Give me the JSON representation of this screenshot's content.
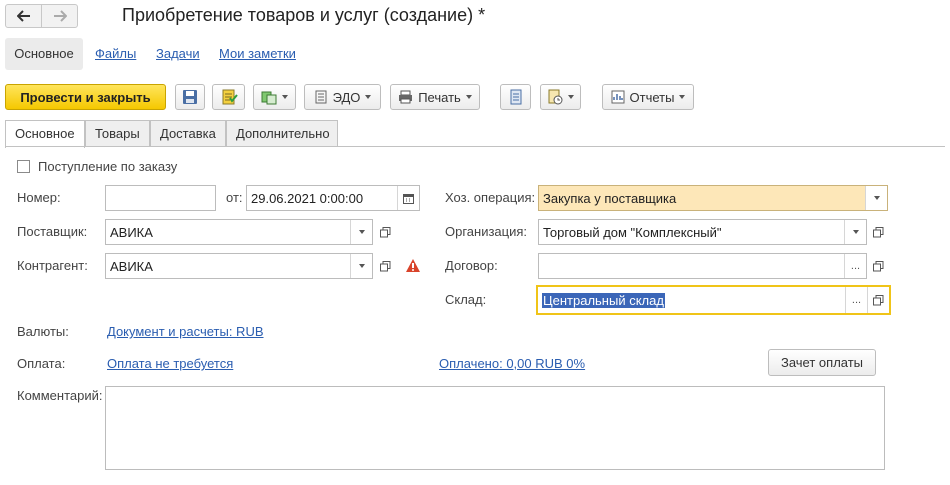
{
  "window": {
    "title": "Приобретение товаров и услуг (создание) *"
  },
  "nav": {
    "back_icon": "arrow-left-icon",
    "forward_icon": "arrow-right-icon"
  },
  "sections": [
    {
      "label": "Основное",
      "active": true
    },
    {
      "label": "Файлы"
    },
    {
      "label": "Задачи"
    },
    {
      "label": "Мои заметки"
    }
  ],
  "toolbar": {
    "post_close": "Провести и закрыть",
    "edo": "ЭДО",
    "print": "Печать",
    "reports": "Отчеты"
  },
  "tabs": [
    {
      "label": "Основное",
      "active": true
    },
    {
      "label": "Товары"
    },
    {
      "label": "Доставка"
    },
    {
      "label": "Дополнительно"
    }
  ],
  "form": {
    "by_order_label": "Поступление по заказу",
    "by_order_checked": false,
    "number_label": "Номер:",
    "number_value": "",
    "date_label": "от:",
    "date_value": "29.06.2021  0:00:00",
    "supplier_label": "Поставщик:",
    "supplier_value": "АВИКА",
    "counterparty_label": "Контрагент:",
    "counterparty_value": "АВИКА",
    "operation_label": "Хоз. операция:",
    "operation_value": "Закупка у поставщика",
    "organization_label": "Организация:",
    "organization_value": "Торговый дом \"Комплексный\"",
    "contract_label": "Договор:",
    "contract_value": "",
    "warehouse_label": "Склад:",
    "warehouse_value": "Центральный склад",
    "currency_label": "Валюты:",
    "currency_link": "Документ и расчеты: RUB",
    "payment_label": "Оплата:",
    "payment_link": "Оплата не требуется",
    "paid_link": "Оплачено: 0,00 RUB 0%",
    "offset_button": "Зачет оплаты",
    "comment_label": "Комментарий:",
    "comment_value": ""
  },
  "colors": {
    "primary_button": "#f5c800",
    "operation_field": "#fde7b8",
    "link": "#2a5db0",
    "warning": "#d9442b"
  }
}
